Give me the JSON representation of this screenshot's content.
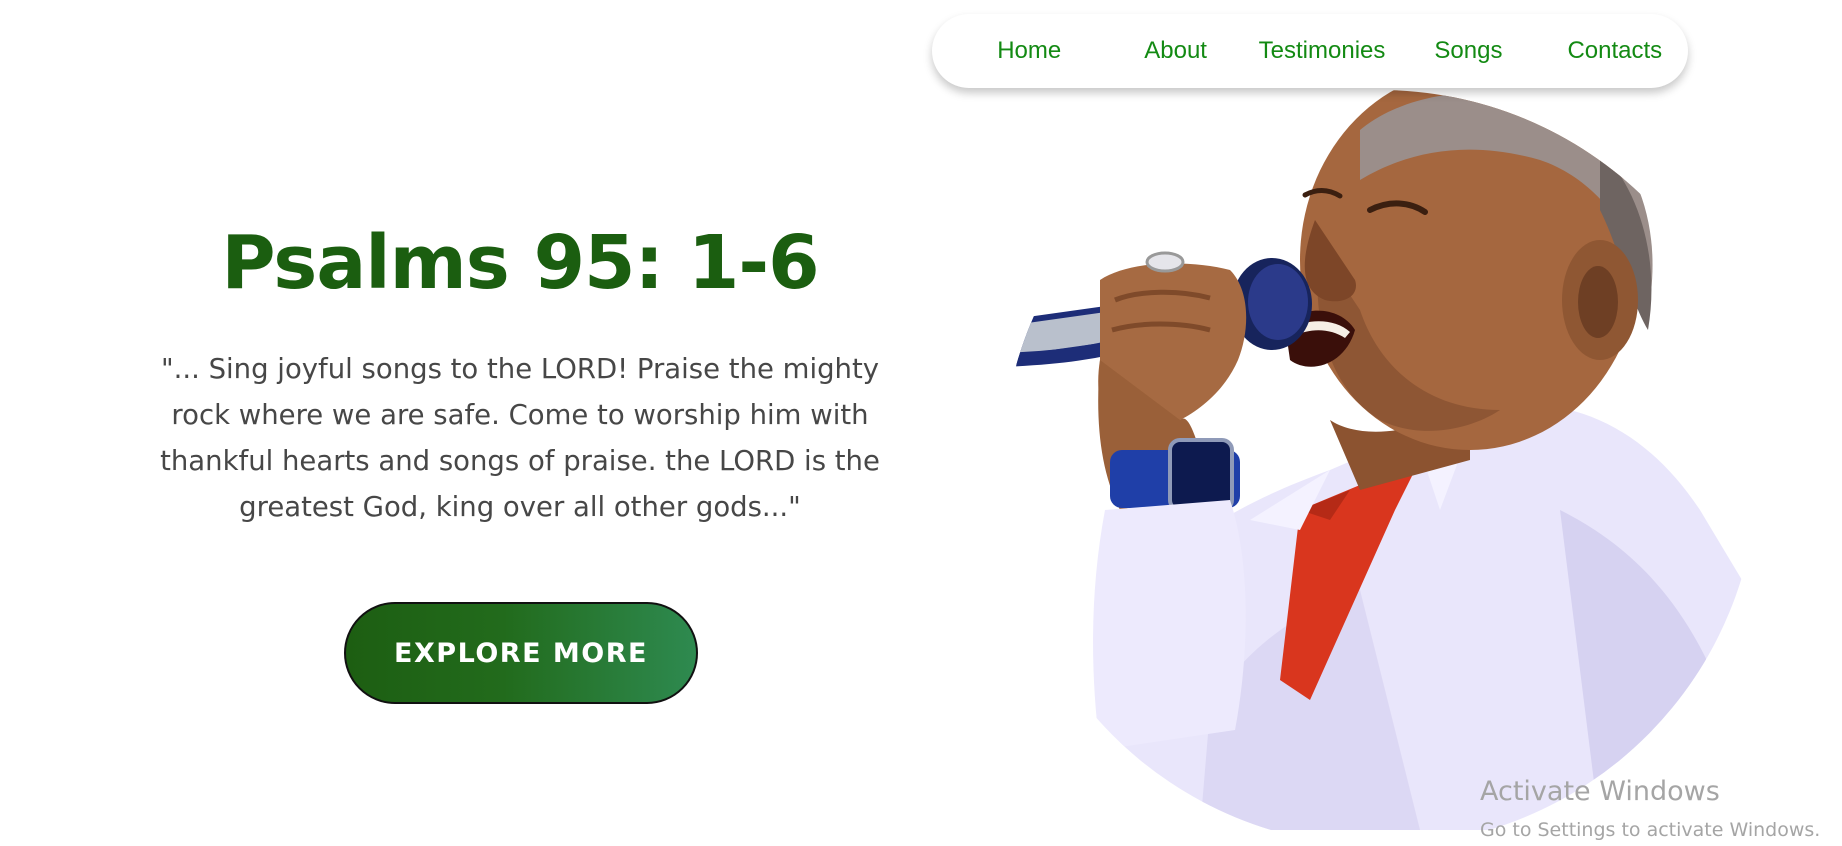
{
  "nav": {
    "items": [
      {
        "label": "Home"
      },
      {
        "label": "About"
      },
      {
        "label": "Testimonies"
      },
      {
        "label": "Songs"
      },
      {
        "label": "Contacts"
      }
    ],
    "link_color": "#138a13"
  },
  "hero": {
    "title": "Psalms 95: 1-6",
    "quote": "\"... Sing joyful songs to the LORD! Praise the mighty rock where we are safe. Come to worship him with thankful hearts and songs of praise. the LORD is the greatest God, king over all other gods...\"",
    "cta_label": "EXPLORE MORE",
    "title_color": "#1b5e10",
    "accent_color": "#1d5e12"
  },
  "image": {
    "subject": "singer-with-microphone-photo"
  },
  "watermark": {
    "title": "Activate Windows",
    "subtitle": "Go to Settings to activate Windows."
  }
}
